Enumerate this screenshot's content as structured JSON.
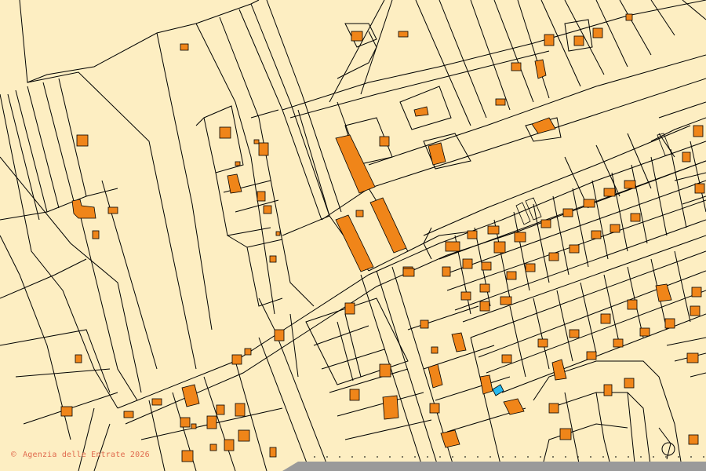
{
  "map": {
    "attribution_symbol": "©",
    "attribution_text": "Agenzia delle Entrate 2026"
  },
  "colors": {
    "background": "#fdeec2",
    "parcel_line": "#000000",
    "building_fill": "#f08519",
    "building_stroke": "#000000",
    "highlight_fill": "#27b9ee",
    "road_strip": "#9a9a9a",
    "attribution": "#e06a4e"
  }
}
